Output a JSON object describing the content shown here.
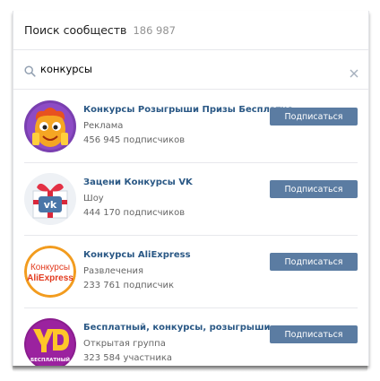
{
  "header": {
    "title": "Поиск сообществ",
    "count": "186 987"
  },
  "search": {
    "value": "конкурсы",
    "placeholder": ""
  },
  "groups": [
    {
      "name": "Конкурсы Розыгрыши Призы Бесплатно",
      "category": "Реклама",
      "members": "456 945 подписчиков",
      "button": "Подписаться"
    },
    {
      "name": "Зацени Конкурсы VK",
      "category": "Шоу",
      "members": "444 170 подписчиков",
      "button": "Подписаться"
    },
    {
      "name": "Конкурсы AliExpress",
      "category": "Развлечения",
      "members": "233 761 подписчик",
      "button": "Подписаться"
    },
    {
      "name": "Бесплатный, конкурсы, розыгрыши",
      "category": "Открытая группа",
      "members": "323 584 участника",
      "button": "Подписаться"
    }
  ],
  "avatars": {
    "aliexpress_line1": "Конкурсы",
    "aliexpress_line2": "AliExpress",
    "free_badge": "БЕСПЛАТНЫЙ"
  },
  "colors": {
    "link": "#2a5885",
    "button": "#5b7ca2",
    "muted": "#656565"
  }
}
